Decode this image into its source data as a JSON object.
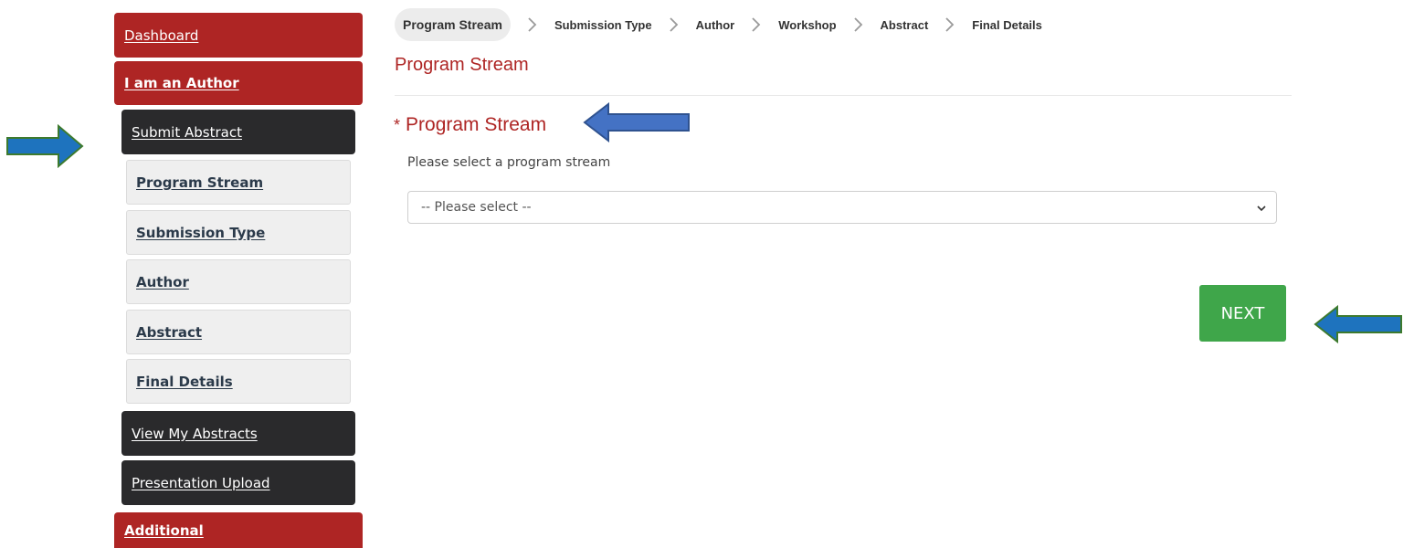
{
  "sidebar": {
    "dashboard": "Dashboard",
    "author_section": "I am an Author",
    "submit_abstract": "Submit Abstract",
    "sub_items": [
      "Program Stream",
      "Submission Type",
      "Author",
      "Abstract",
      "Final Details"
    ],
    "view_abstracts": "View My Abstracts",
    "presentation_upload": "Presentation Upload",
    "additional": "Additional"
  },
  "steps": [
    "Program Stream",
    "Submission Type",
    "Author",
    "Workshop",
    "Abstract",
    "Final Details"
  ],
  "main": {
    "page_title": "Program Stream",
    "required_mark": "*",
    "field_label": "Program Stream",
    "help_text": "Please select a program stream",
    "select_value": "-- Please select --",
    "next_label": "NEXT"
  },
  "colors": {
    "brand_red": "#ae2524",
    "dark_nav": "#2a2a2c",
    "next_green": "#3fa64a",
    "annotation_blue": "#3a6fc4"
  }
}
